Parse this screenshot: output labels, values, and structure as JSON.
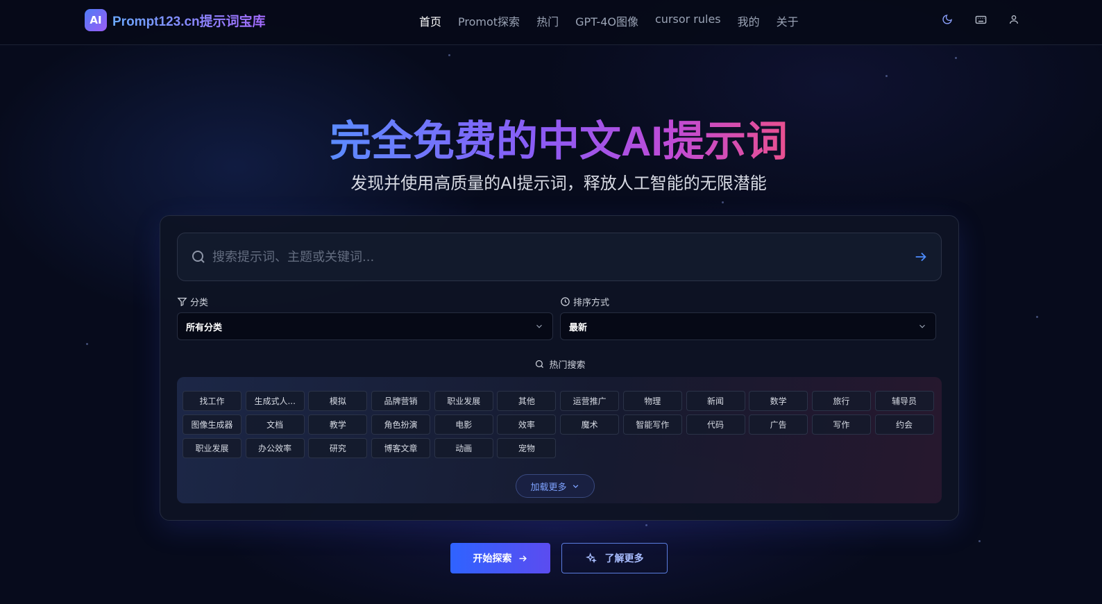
{
  "header": {
    "logo_badge": "AI",
    "logo_text": "Prompt123.cn提示词宝库",
    "nav": [
      "首页",
      "Promot探索",
      "热门",
      "GPT-4O图像",
      "cursor rules",
      "我的",
      "关于"
    ],
    "icons": [
      "moon-icon",
      "keyboard-icon",
      "user-icon"
    ]
  },
  "hero": {
    "title": "完全免费的中文AI提示词",
    "subtitle": "发现并使用高质量的AI提示词，释放人工智能的无限潜能"
  },
  "search": {
    "placeholder": "搜索提示词、主题或关键词..."
  },
  "filters": {
    "category_label": "分类",
    "category_value": "所有分类",
    "sort_label": "排序方式",
    "sort_value": "最新"
  },
  "hot": {
    "label": "热门搜索",
    "tags": [
      "找工作",
      "生成式人...",
      "模拟",
      "品牌营销",
      "职业发展",
      "其他",
      "运营推广",
      "物理",
      "新闻",
      "数学",
      "旅行",
      "辅导员",
      "图像生成器",
      "文档",
      "教学",
      "角色扮演",
      "电影",
      "效率",
      "魔术",
      "智能写作",
      "代码",
      "广告",
      "写作",
      "约会",
      "职业发展",
      "办公效率",
      "研究",
      "博客文章",
      "动画",
      "宠物"
    ],
    "load_more": "加载更多"
  },
  "actions": {
    "explore": "开始探索",
    "learn_more": "了解更多"
  },
  "colors": {
    "background": "#070b1c",
    "accent_blue": "#2f63ff",
    "title_gradient_start": "#5b8cff",
    "title_gradient_end": "#e9508f"
  }
}
